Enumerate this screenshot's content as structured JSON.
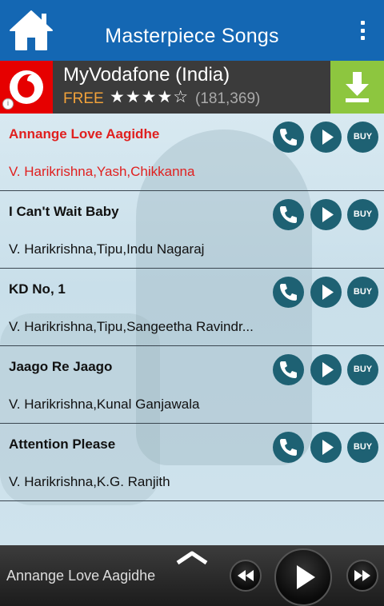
{
  "header": {
    "title": "Masterpiece Songs",
    "home_icon": "home-icon",
    "menu_icon": "overflow-menu-icon",
    "background": "#1467b3"
  },
  "ad": {
    "app_name": "MyVodafone (India)",
    "price": "FREE",
    "stars": "★★★★☆",
    "rating_count": "(181,369)",
    "rating_value": 4,
    "info_label": "i",
    "download_icon": "download-icon",
    "brand_color": "#e60000"
  },
  "songs": [
    {
      "title": "Annange Love Aagidhe",
      "artist": "V. Harikrishna,Yash,Chikkanna",
      "buy_label": "BUY"
    },
    {
      "title": "I Can't Wait Baby",
      "artist": "V. Harikrishna,Tipu,Indu Nagaraj",
      "buy_label": "BUY"
    },
    {
      "title": "KD No, 1",
      "artist": "V. Harikrishna,Tipu,Sangeetha Ravindr...",
      "buy_label": "BUY"
    },
    {
      "title": "Jaago Re Jaago",
      "artist": "V. Harikrishna,Kunal Ganjawala",
      "buy_label": "BUY"
    },
    {
      "title": "Attention Please",
      "artist": "V. Harikrishna,K.G. Ranjith",
      "buy_label": "BUY"
    }
  ],
  "active_song_color": "#e0201f",
  "player": {
    "now_playing": "Annange Love Aagidhe",
    "expand_icon": "chevron-up-icon",
    "prev_icon": "rewind-icon",
    "play_icon": "play-icon",
    "next_icon": "fast-forward-icon"
  }
}
